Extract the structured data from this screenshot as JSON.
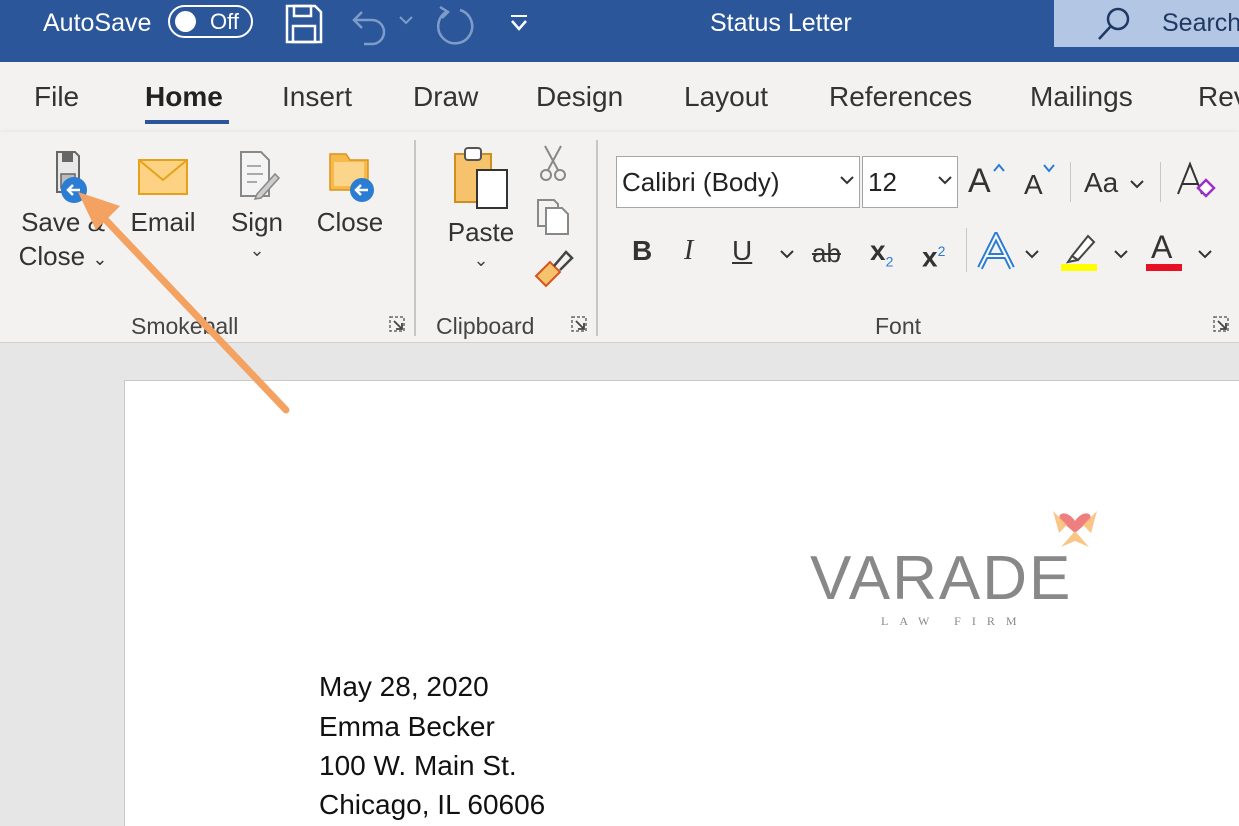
{
  "titlebar": {
    "autosave_label": "AutoSave",
    "autosave_state": "Off",
    "document_title": "Status Letter",
    "search_placeholder": "Search",
    "icons": [
      "save-icon",
      "undo-icon",
      "redo-icon",
      "customize-toolbar-icon",
      "search-icon"
    ]
  },
  "tabs": [
    {
      "label": "File"
    },
    {
      "label": "Home",
      "active": true
    },
    {
      "label": "Insert"
    },
    {
      "label": "Draw"
    },
    {
      "label": "Design"
    },
    {
      "label": "Layout"
    },
    {
      "label": "References"
    },
    {
      "label": "Mailings"
    },
    {
      "label": "Rev"
    }
  ],
  "ribbon": {
    "smokeball": {
      "group_label": "Smokeball",
      "save_close_line1": "Save &",
      "save_close_line2": "Close",
      "email": "Email",
      "sign": "Sign",
      "close": "Close"
    },
    "clipboard": {
      "group_label": "Clipboard",
      "paste": "Paste"
    },
    "font": {
      "group_label": "Font",
      "font_name": "Calibri (Body)",
      "font_size": "12",
      "grow_font": "A",
      "shrink_font": "A",
      "change_case": "Aa",
      "bold": "B",
      "italic": "I",
      "underline": "U",
      "strikethrough": "ab",
      "subscript_base": "x",
      "subscript_mark": "2",
      "superscript_base": "x",
      "superscript_mark": "2",
      "text_effects": "A",
      "font_color": "A"
    }
  },
  "document": {
    "logo_name": "VARADE",
    "logo_subtitle": "LAW FIRM",
    "lines": [
      "May 28, 2020",
      "Emma Becker",
      "100 W. Main St.",
      "Chicago, IL 60606"
    ]
  },
  "colors": {
    "titlebar": "#2b579a",
    "ribbon_bg": "#f3f2f1",
    "annotation_arrow": "#f4a261",
    "highlight_yellow": "#ffff00",
    "font_color_red": "#e81123"
  }
}
